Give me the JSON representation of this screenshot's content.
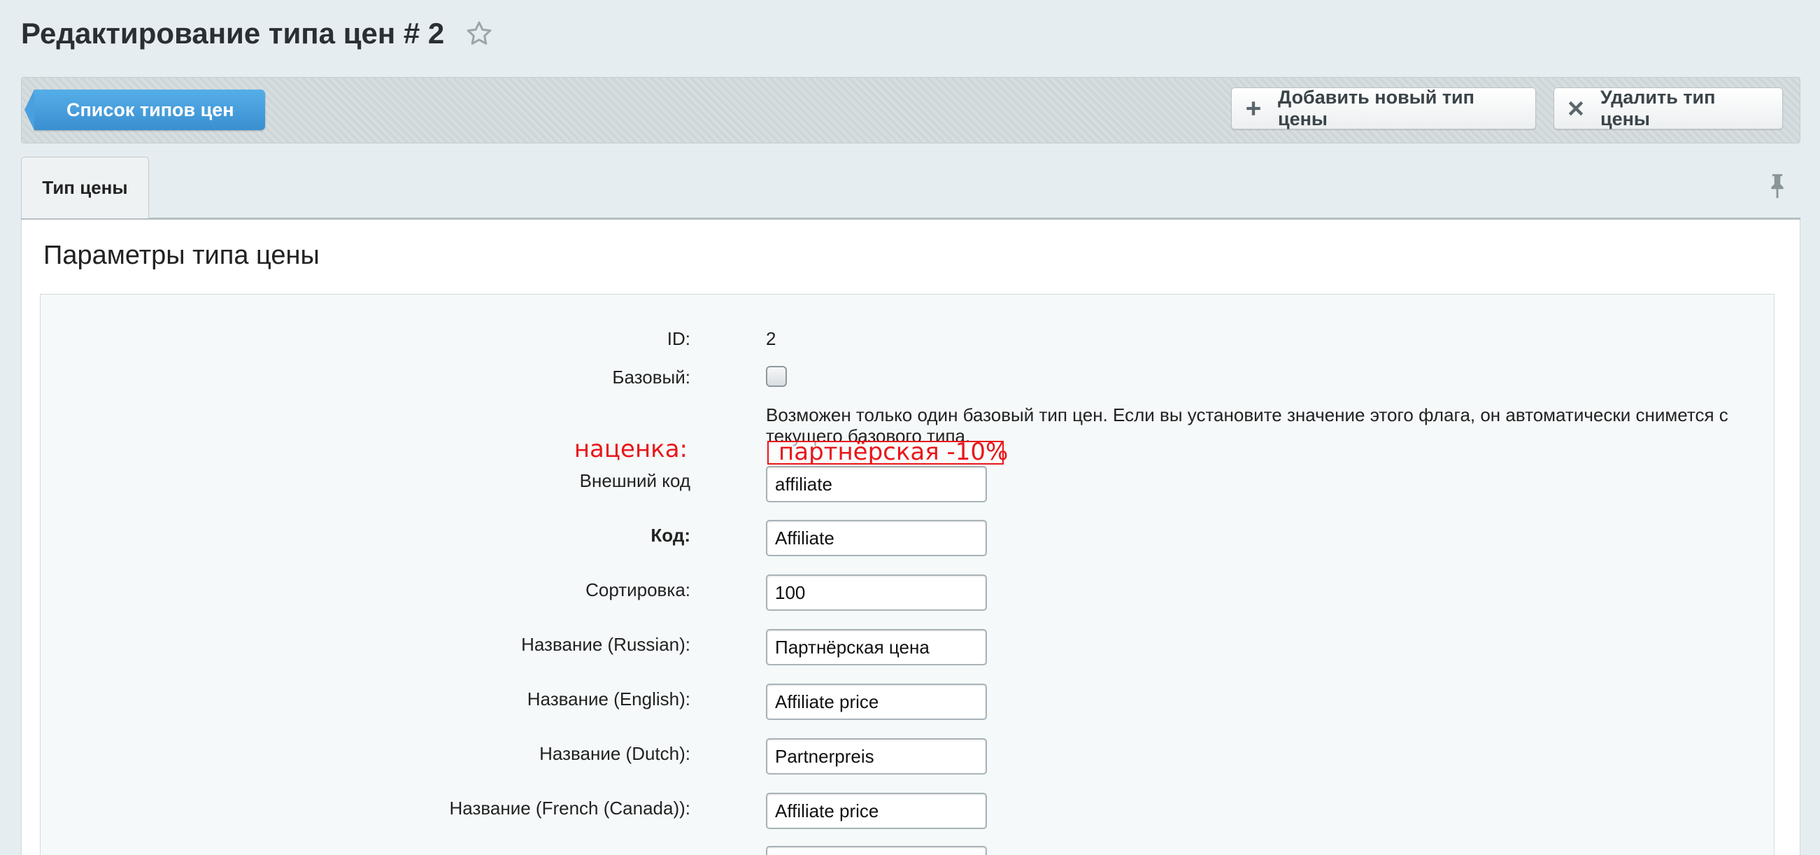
{
  "page": {
    "title": "Редактирование типа цен # 2"
  },
  "toolbar": {
    "back_label": "Список типов цен",
    "add_label": "Добавить новый тип цены",
    "delete_label": "Удалить тип цены"
  },
  "tabs": [
    {
      "label": "Тип цены"
    }
  ],
  "section": {
    "title": "Параметры типа цены"
  },
  "form": {
    "id_label": "ID:",
    "id_value": "2",
    "base_label": "Базовый:",
    "base_checked": false,
    "base_hint": "Возможен только один базовый тип цен. Если вы установите значение этого флага, он автоматически снимется с текущего базового типа.",
    "markup_label": "наценка:",
    "markup_value": "партнёрская -10%",
    "xml_id_label": "Внешний код",
    "xml_id_value": "affiliate",
    "code_label": "Код:",
    "code_value": "Affiliate",
    "sort_label": "Сортировка:",
    "sort_value": "100",
    "name_ru_label": "Название (Russian):",
    "name_ru_value": "Партнёрская цена",
    "name_en_label": "Название (English):",
    "name_en_value": "Affiliate price",
    "name_nl_label": "Название (Dutch):",
    "name_nl_value": "Partnerpreis",
    "name_fr_label": "Название (French (Canada)):",
    "name_fr_value": "Affiliate price"
  },
  "colors": {
    "accent_blue": "#3a8fd0",
    "annotation_red": "#e8161a",
    "background": "#e6edf0"
  },
  "icons": [
    "star-icon",
    "plus-icon",
    "close-icon",
    "pin-icon"
  ]
}
